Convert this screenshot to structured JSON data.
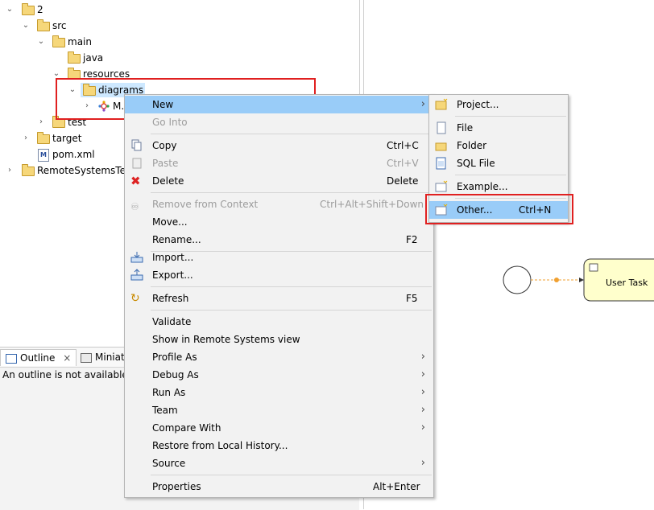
{
  "tree": {
    "items": [
      {
        "label": "2"
      },
      {
        "label": "src"
      },
      {
        "label": "main"
      },
      {
        "label": "java"
      },
      {
        "label": "resources"
      },
      {
        "label": "diagrams"
      },
      {
        "label": "M..."
      },
      {
        "label": "test"
      },
      {
        "label": "target"
      },
      {
        "label": "pom.xml"
      },
      {
        "label": "RemoteSystemsTe..."
      }
    ]
  },
  "outline": {
    "tab_outline": "Outline",
    "tab_miniature": "Miniatu...",
    "message": "An outline is not available."
  },
  "context_menu": {
    "items": [
      {
        "label": "New",
        "shortcut": ""
      },
      {
        "label": "Go Into",
        "shortcut": ""
      },
      {
        "label": "Copy",
        "shortcut": "Ctrl+C"
      },
      {
        "label": "Paste",
        "shortcut": "Ctrl+V"
      },
      {
        "label": "Delete",
        "shortcut": "Delete"
      },
      {
        "label": "Remove from Context",
        "shortcut": "Ctrl+Alt+Shift+Down"
      },
      {
        "label": "Move...",
        "shortcut": ""
      },
      {
        "label": "Rename...",
        "shortcut": "F2"
      },
      {
        "label": "Import...",
        "shortcut": ""
      },
      {
        "label": "Export...",
        "shortcut": ""
      },
      {
        "label": "Refresh",
        "shortcut": "F5"
      },
      {
        "label": "Validate",
        "shortcut": ""
      },
      {
        "label": "Show in Remote Systems view",
        "shortcut": ""
      },
      {
        "label": "Profile As",
        "shortcut": ""
      },
      {
        "label": "Debug As",
        "shortcut": ""
      },
      {
        "label": "Run As",
        "shortcut": ""
      },
      {
        "label": "Team",
        "shortcut": ""
      },
      {
        "label": "Compare With",
        "shortcut": ""
      },
      {
        "label": "Restore from Local History...",
        "shortcut": ""
      },
      {
        "label": "Source",
        "shortcut": ""
      },
      {
        "label": "Properties",
        "shortcut": "Alt+Enter"
      }
    ]
  },
  "submenu": {
    "items": [
      {
        "label": "Project...",
        "shortcut": ""
      },
      {
        "label": "File",
        "shortcut": ""
      },
      {
        "label": "Folder",
        "shortcut": ""
      },
      {
        "label": "SQL File",
        "shortcut": ""
      },
      {
        "label": "Example...",
        "shortcut": ""
      },
      {
        "label": "Other...",
        "shortcut": "Ctrl+N"
      }
    ]
  },
  "diagram": {
    "task_label": "User Task"
  },
  "colors": {
    "highlight": "#99ccf8",
    "annotation_red": "#e02020",
    "task_fill": "#ffffcc",
    "flow_orange": "#f0a030"
  }
}
